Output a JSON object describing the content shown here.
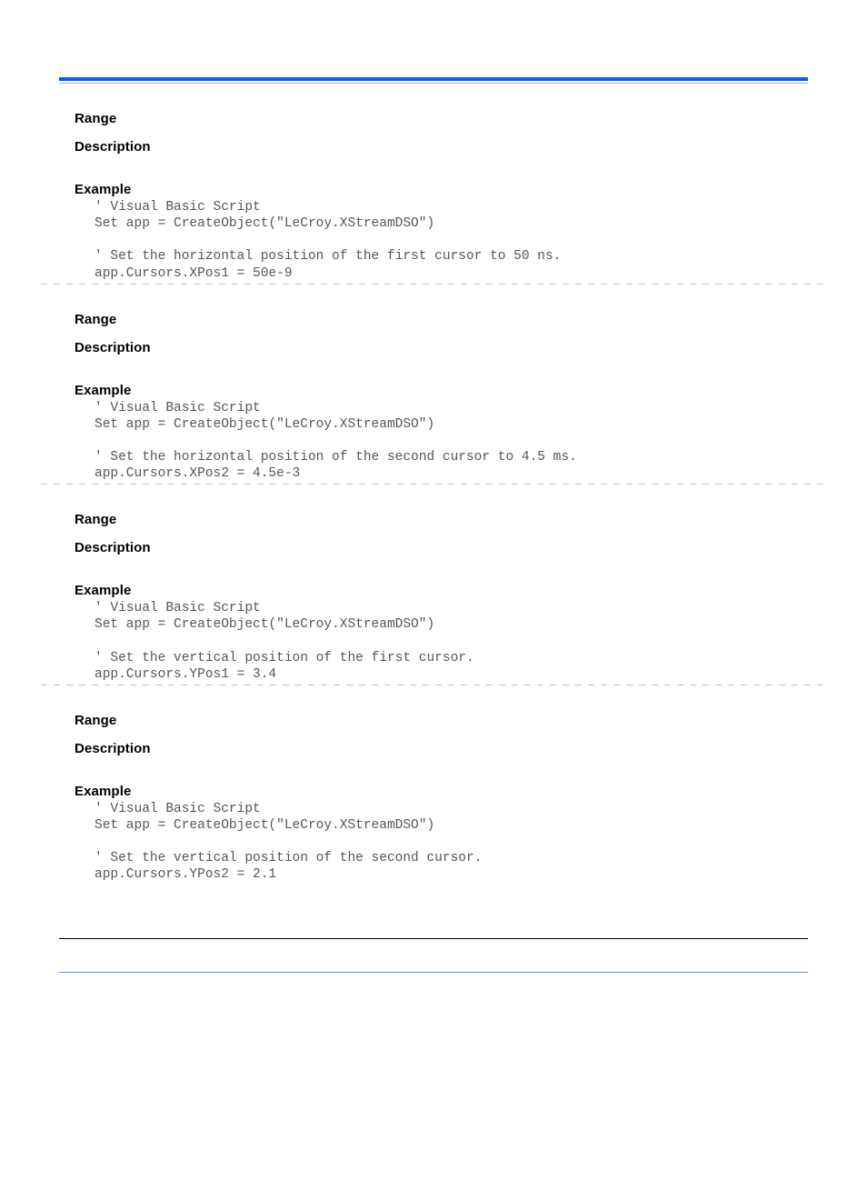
{
  "labels": {
    "range": "Range",
    "description": "Description",
    "example": "Example"
  },
  "sections": [
    {
      "code": "' Visual Basic Script\nSet app = CreateObject(\"LeCroy.XStreamDSO\")\n\n' Set the horizontal position of the first cursor to 50 ns.\napp.Cursors.XPos1 = 50e-9",
      "divider": true
    },
    {
      "code": "' Visual Basic Script\nSet app = CreateObject(\"LeCroy.XStreamDSO\")\n\n' Set the horizontal position of the second cursor to 4.5 ms.\napp.Cursors.XPos2 = 4.5e-3",
      "divider": true
    },
    {
      "code": "' Visual Basic Script\nSet app = CreateObject(\"LeCroy.XStreamDSO\")\n\n' Set the vertical position of the first cursor.\napp.Cursors.YPos1 = 3.4",
      "divider": true
    },
    {
      "code": "' Visual Basic Script\nSet app = CreateObject(\"LeCroy.XStreamDSO\")\n\n' Set the vertical position of the second cursor.\napp.Cursors.YPos2 = 2.1",
      "divider": false
    }
  ]
}
